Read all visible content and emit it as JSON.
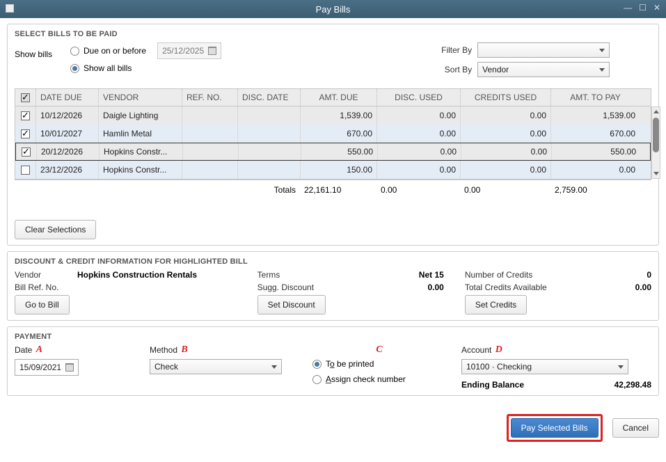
{
  "window": {
    "title": "Pay Bills"
  },
  "select_bills": {
    "heading": "SELECT BILLS TO BE PAID",
    "show_bills_label": "Show bills",
    "option_due_label": "Due on or before",
    "option_all_label": "Show all bills",
    "selected_option": "all",
    "due_date": "25/12/2025",
    "filter_by_label": "Filter By",
    "filter_by_value": "",
    "sort_by_label": "Sort By",
    "sort_by_value": "Vendor"
  },
  "table": {
    "columns": {
      "date_due": "DATE DUE",
      "vendor": "VENDOR",
      "ref_no": "REF. NO.",
      "disc_date": "DISC. DATE",
      "amt_due": "AMT. DUE",
      "disc_used": "DISC. USED",
      "credits_used": "CREDITS USED",
      "amt_to_pay": "AMT. TO PAY"
    },
    "rows": [
      {
        "checked": true,
        "date_due": "10/12/2026",
        "vendor": "Daigle Lighting",
        "ref_no": "",
        "disc_date": "",
        "amt_due": "1,539.00",
        "disc_used": "0.00",
        "credits_used": "0.00",
        "amt_to_pay": "1,539.00"
      },
      {
        "checked": true,
        "date_due": "10/01/2027",
        "vendor": "Hamlin Metal",
        "ref_no": "",
        "disc_date": "",
        "amt_due": "670.00",
        "disc_used": "0.00",
        "credits_used": "0.00",
        "amt_to_pay": "670.00"
      },
      {
        "checked": true,
        "date_due": "20/12/2026",
        "vendor": "Hopkins Constr...",
        "ref_no": "",
        "disc_date": "",
        "amt_due": "550.00",
        "disc_used": "0.00",
        "credits_used": "0.00",
        "amt_to_pay": "550.00"
      },
      {
        "checked": false,
        "date_due": "23/12/2026",
        "vendor": "Hopkins Constr...",
        "ref_no": "",
        "disc_date": "",
        "amt_due": "150.00",
        "disc_used": "0.00",
        "credits_used": "0.00",
        "amt_to_pay": "0.00"
      }
    ],
    "totals": {
      "label": "Totals",
      "amt_due": "22,161.10",
      "disc_used": "0.00",
      "credits_used": "0.00",
      "amt_to_pay": "2,759.00"
    },
    "clear_btn": "Clear Selections"
  },
  "discount_info": {
    "heading": "DISCOUNT & CREDIT INFORMATION FOR HIGHLIGHTED BILL",
    "vendor_label": "Vendor",
    "vendor_value": "Hopkins Construction Rentals",
    "billref_label": "Bill Ref. No.",
    "billref_value": "",
    "terms_label": "Terms",
    "terms_value": "Net 15",
    "sugg_label": "Sugg. Discount",
    "sugg_value": "0.00",
    "numcredits_label": "Number of Credits",
    "numcredits_value": "0",
    "totalcredits_label": "Total Credits Available",
    "totalcredits_value": "0.00",
    "goto_btn": "Go to Bill",
    "setdisc_btn": "Set Discount",
    "setcred_btn": "Set Credits"
  },
  "payment": {
    "heading": "PAYMENT",
    "date_label": "Date",
    "date_value": "15/09/2021",
    "method_label": "Method",
    "method_value": "Check",
    "print_label_pre": "T",
    "print_label_u": "o",
    "print_label_post": " be printed",
    "assign_label_pre": "",
    "assign_label_u": "A",
    "assign_label_post": "ssign check number",
    "print_option": "printed",
    "account_label": "Account",
    "account_value": "10100 · Checking",
    "ending_label": "Ending Balance",
    "ending_value": "42,298.48",
    "letters": {
      "a": "A",
      "b": "B",
      "c": "C",
      "d": "D"
    }
  },
  "footer": {
    "pay_btn": "Pay Selected Bills",
    "cancel_btn": "Cancel"
  }
}
